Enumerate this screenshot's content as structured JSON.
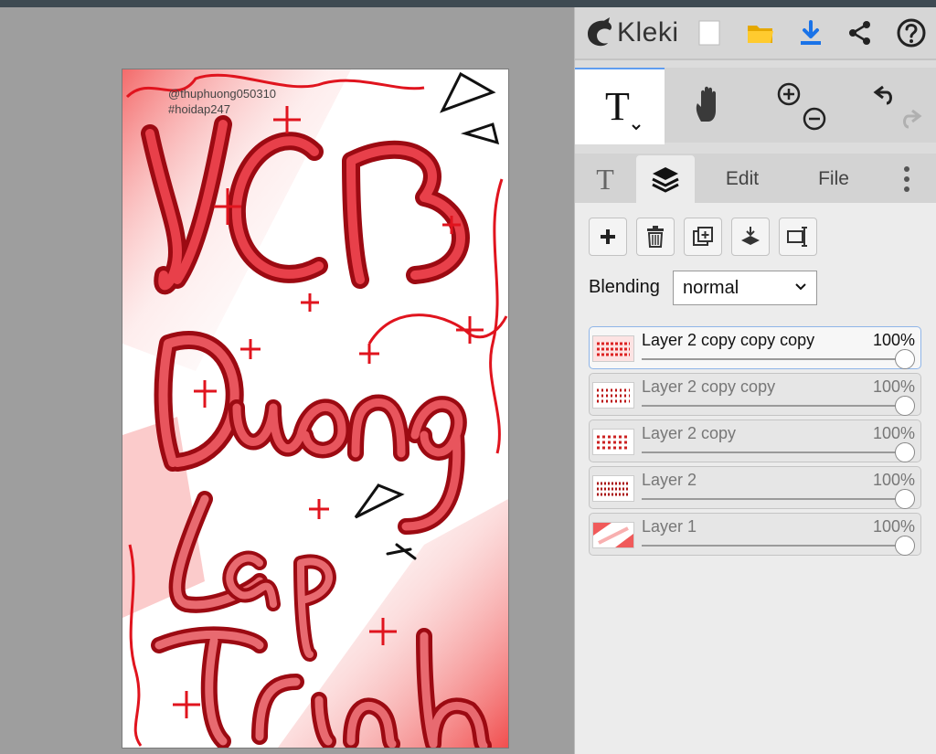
{
  "app": {
    "name": "Kleki"
  },
  "canvas": {
    "caption_line1": "@thuphuong050310",
    "caption_line2": "#hoidap247"
  },
  "toolbar": {
    "icons": [
      "new-image-icon",
      "open-folder-icon",
      "download-icon",
      "share-icon",
      "help-icon"
    ],
    "tools": [
      "text-tool",
      "hand-tool",
      "zoom-in",
      "zoom-out",
      "undo",
      "redo"
    ]
  },
  "tabs": {
    "text_tab": "T",
    "edit": "Edit",
    "file": "File"
  },
  "layers_panel": {
    "blending_label": "Blending",
    "blending_value": "normal",
    "layers": [
      {
        "name": "Layer 2 copy copy copy",
        "opacity": "100%",
        "opacity_value": 1.0,
        "active": true
      },
      {
        "name": "Layer 2 copy copy",
        "opacity": "100%",
        "opacity_value": 1.0,
        "active": false
      },
      {
        "name": "Layer 2 copy",
        "opacity": "100%",
        "opacity_value": 1.0,
        "active": false
      },
      {
        "name": "Layer 2",
        "opacity": "100%",
        "opacity_value": 1.0,
        "active": false
      },
      {
        "name": "Layer 1",
        "opacity": "100%",
        "opacity_value": 1.0,
        "active": false
      }
    ]
  },
  "colors": {
    "accent": "#1a73e8",
    "brush_red": "#e0141e",
    "dark_red": "#9c0a12"
  }
}
